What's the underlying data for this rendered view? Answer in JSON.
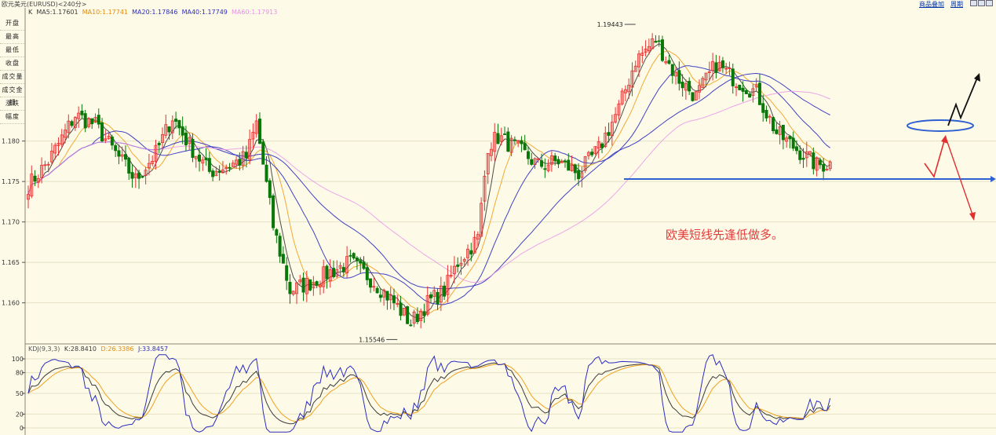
{
  "window": {
    "title": "欧元美元(EURUSD)<240分>",
    "links": [
      "商品叠加",
      "周期"
    ]
  },
  "indicators": {
    "k_label": "K",
    "ma_line": [
      {
        "text": "MA5:1.17601",
        "color": "#3a3a3a"
      },
      {
        "text": "MA10:1.17741",
        "color": "#f0a020"
      },
      {
        "text": "MA20:1.17846",
        "color": "#2c2cc0"
      },
      {
        "text": "MA40:1.17749",
        "color": "#2c2cc0"
      },
      {
        "text": "MA60:1.17913",
        "color": "#e890e8"
      }
    ],
    "kdj_line": [
      {
        "text": "KDJ(9,3,3)",
        "color": "#555555"
      },
      {
        "text": "K:28.8410",
        "color": "#3a3a3a"
      },
      {
        "text": "D:26.3386",
        "color": "#f0a020"
      },
      {
        "text": "J:33.8457",
        "color": "#2c2cc0"
      }
    ]
  },
  "sidebar": {
    "items": [
      "开盘",
      "最高",
      "最低",
      "收盘",
      "成交量",
      "成交金额",
      "涨跌",
      "幅度"
    ]
  },
  "annotation": {
    "text": "欧美短线先逢低做多。",
    "color": "#e63a3a"
  },
  "chart_data": [
    {
      "type": "candlestick",
      "title": "欧元美元(EURUSD)<240分>",
      "ylim": [
        1.1555,
        1.1955
      ],
      "yticks": [
        "1.160",
        "1.165",
        "1.170",
        "1.175",
        "1.180"
      ],
      "bar_count": 240,
      "bullish_color": "#e83030",
      "bearish_color": "#087808",
      "high_label": "1.19443",
      "low_label": "1.15546",
      "support_level": 1.1753,
      "anchors": [
        [
          0,
          1.1745
        ],
        [
          6,
          1.1775
        ],
        [
          14,
          1.1832
        ],
        [
          20,
          1.182
        ],
        [
          26,
          1.1785
        ],
        [
          32,
          1.1752
        ],
        [
          38,
          1.1785
        ],
        [
          43,
          1.183
        ],
        [
          48,
          1.1795
        ],
        [
          54,
          1.1762
        ],
        [
          60,
          1.177
        ],
        [
          65,
          1.178
        ],
        [
          68,
          1.1822
        ],
        [
          73,
          1.1695
        ],
        [
          78,
          1.1615
        ],
        [
          84,
          1.1625
        ],
        [
          90,
          1.1638
        ],
        [
          96,
          1.165
        ],
        [
          102,
          1.163
        ],
        [
          108,
          1.1605
        ],
        [
          114,
          1.1575
        ],
        [
          119,
          1.16
        ],
        [
          124,
          1.1615
        ],
        [
          128,
          1.165
        ],
        [
          134,
          1.168
        ],
        [
          137,
          1.1795
        ],
        [
          140,
          1.1805
        ],
        [
          146,
          1.179
        ],
        [
          152,
          1.177
        ],
        [
          158,
          1.1775
        ],
        [
          164,
          1.176
        ],
        [
          170,
          1.179
        ],
        [
          176,
          1.184
        ],
        [
          181,
          1.19
        ],
        [
          187,
          1.1925
        ],
        [
          193,
          1.188
        ],
        [
          199,
          1.1855
        ],
        [
          205,
          1.1895
        ],
        [
          211,
          1.1875
        ],
        [
          217,
          1.186
        ],
        [
          223,
          1.181
        ],
        [
          229,
          1.179
        ],
        [
          235,
          1.177
        ],
        [
          241,
          1.1773
        ],
        [
          247,
          1.174
        ],
        [
          253,
          1.178
        ],
        [
          257,
          1.1745
        ],
        [
          263,
          1.18
        ],
        [
          268,
          1.179
        ],
        [
          272,
          1.177
        ]
      ],
      "moving_averages": [
        {
          "name": "MA5",
          "value": 1.17601,
          "color": "#3a3a3a"
        },
        {
          "name": "MA10",
          "value": 1.17741,
          "color": "#f0a020"
        },
        {
          "name": "MA20",
          "value": 1.17846,
          "color": "#2c2cc0"
        },
        {
          "name": "MA40",
          "value": 1.17749,
          "color": "#2c2cc0"
        },
        {
          "name": "MA60",
          "value": 1.17913,
          "color": "#e890e8"
        }
      ]
    },
    {
      "type": "line",
      "title": "KDJ(9,3,3)",
      "ylim": [
        -8,
        108
      ],
      "yticks": [
        "0",
        "20",
        "50",
        "80",
        "100"
      ],
      "series": [
        {
          "name": "K",
          "value": 28.841,
          "color": "#3a3a3a"
        },
        {
          "name": "D",
          "value": 26.3386,
          "color": "#f0a020"
        },
        {
          "name": "J",
          "value": 33.8457,
          "color": "#2c2cc0"
        }
      ]
    }
  ]
}
